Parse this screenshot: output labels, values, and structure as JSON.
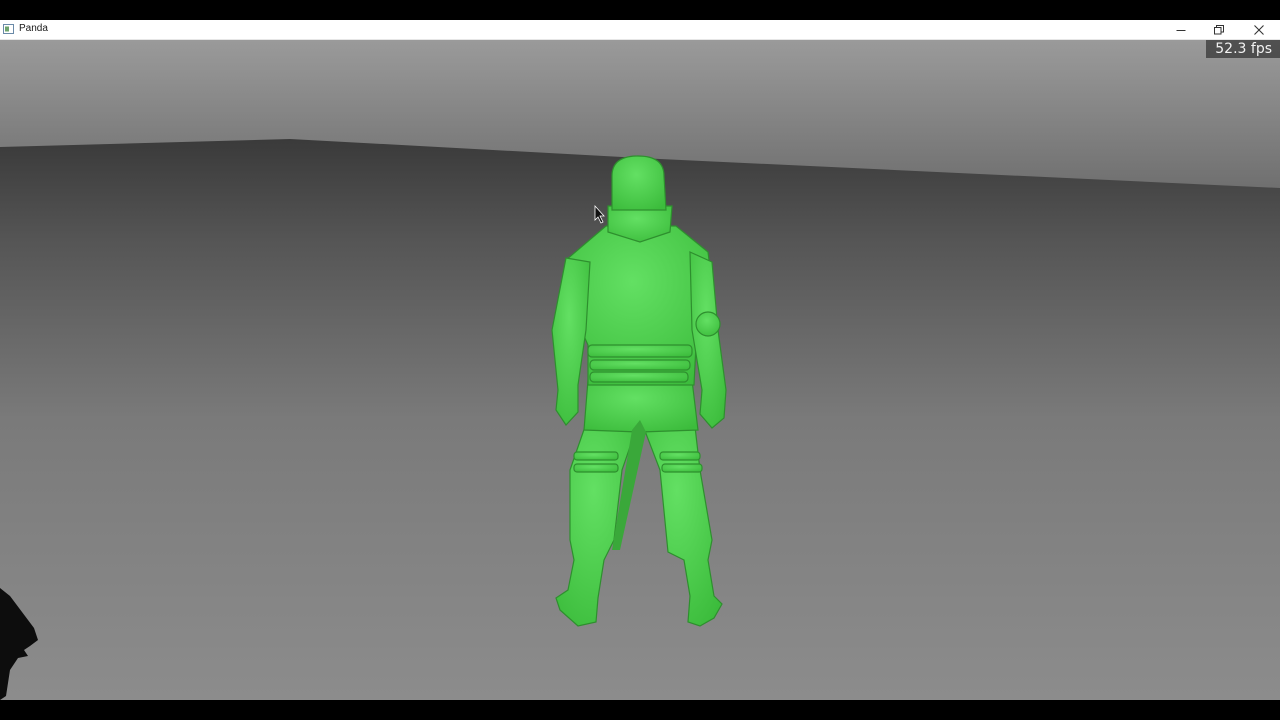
{
  "window": {
    "title": "Panda",
    "minimize_label": "minimize",
    "restore_label": "restore",
    "close_label": "close"
  },
  "hud": {
    "fps_text": "52.3 fps"
  },
  "scene": {
    "character_color": "#4fd24f",
    "ground_color": "#8a8a8a",
    "sky_color": "#8c8c8c"
  }
}
